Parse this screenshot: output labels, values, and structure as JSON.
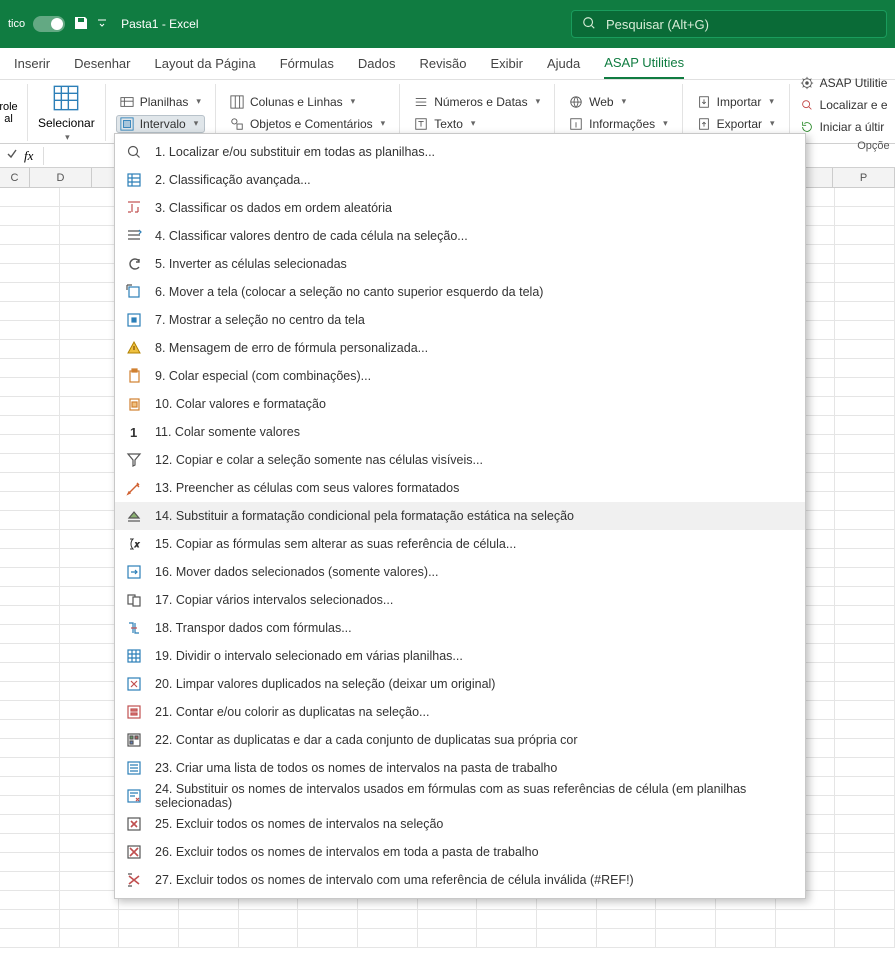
{
  "titlebar": {
    "autosave_label": "tico",
    "filename": "Pasta1  -  Excel",
    "search_placeholder": "Pesquisar (Alt+G)"
  },
  "tabs": [
    "Inserir",
    "Desenhar",
    "Layout da Página",
    "Fórmulas",
    "Dados",
    "Revisão",
    "Exibir",
    "Ajuda",
    "ASAP Utilities"
  ],
  "activeTab": "ASAP Utilities",
  "ribbon": {
    "big1": "role\nal",
    "big2": "Selecionar",
    "planilhas": "Planilhas",
    "intervalo": "Intervalo",
    "colunas": "Colunas e Linhas",
    "objetos": "Objetos e Comentários",
    "numeros": "Números e Datas",
    "texto": "Texto",
    "web": "Web",
    "info": "Informações",
    "importar": "Importar",
    "exportar": "Exportar",
    "asap": "ASAP Utilitie",
    "localizar": "Localizar e e",
    "iniciar": "Iniciar a últir",
    "opcoes": "Opçõe"
  },
  "columns": [
    "C",
    "D",
    "",
    "",
    "",
    "",
    "",
    "",
    "",
    "",
    "",
    "",
    "P"
  ],
  "menu": [
    {
      "n": "1.",
      "label": "Localizar e/ou substituir em todas as planilhas..."
    },
    {
      "n": "2.",
      "label": "Classificação avançada..."
    },
    {
      "n": "3.",
      "label": "Classificar os dados em ordem aleatória"
    },
    {
      "n": "4.",
      "label": "Classificar valores dentro de cada célula na seleção..."
    },
    {
      "n": "5.",
      "label": "Inverter as células selecionadas"
    },
    {
      "n": "6.",
      "label": "Mover a tela (colocar a seleção no canto superior esquerdo da tela)"
    },
    {
      "n": "7.",
      "label": "Mostrar a seleção no centro da tela"
    },
    {
      "n": "8.",
      "label": "Mensagem de erro de fórmula personalizada..."
    },
    {
      "n": "9.",
      "label": "Colar especial (com combinações)..."
    },
    {
      "n": "10.",
      "label": "Colar valores e formatação"
    },
    {
      "n": "11.",
      "label": "Colar somente valores"
    },
    {
      "n": "12.",
      "label": "Copiar e colar a seleção somente nas células visíveis..."
    },
    {
      "n": "13.",
      "label": "Preencher as células com seus valores formatados"
    },
    {
      "n": "14.",
      "label": "Substituir a formatação condicional pela formatação estática na seleção"
    },
    {
      "n": "15.",
      "label": "Copiar as fórmulas sem alterar as suas referência de célula..."
    },
    {
      "n": "16.",
      "label": "Mover dados selecionados (somente valores)..."
    },
    {
      "n": "17.",
      "label": "Copiar vários intervalos selecionados..."
    },
    {
      "n": "18.",
      "label": "Transpor dados com fórmulas..."
    },
    {
      "n": "19.",
      "label": "Dividir o intervalo selecionado em várias planilhas..."
    },
    {
      "n": "20.",
      "label": "Limpar valores duplicados na seleção (deixar um original)"
    },
    {
      "n": "21.",
      "label": "Contar e/ou colorir as duplicatas na seleção..."
    },
    {
      "n": "22.",
      "label": "Contar as duplicatas e dar a cada conjunto de duplicatas sua própria cor"
    },
    {
      "n": "23.",
      "label": "Criar uma lista de todos os nomes de intervalos na pasta de trabalho"
    },
    {
      "n": "24.",
      "label": "Substituir os nomes de intervalos usados em fórmulas com as suas referências de célula (em planilhas selecionadas)"
    },
    {
      "n": "25.",
      "label": "Excluir todos os nomes de intervalos na seleção"
    },
    {
      "n": "26.",
      "label": "Excluir todos os nomes de intervalos em toda a pasta de trabalho"
    },
    {
      "n": "27.",
      "label": "Excluir todos os nomes de intervalo com uma referência de célula inválida (#REF!)"
    }
  ],
  "hoveredMenu": 13
}
